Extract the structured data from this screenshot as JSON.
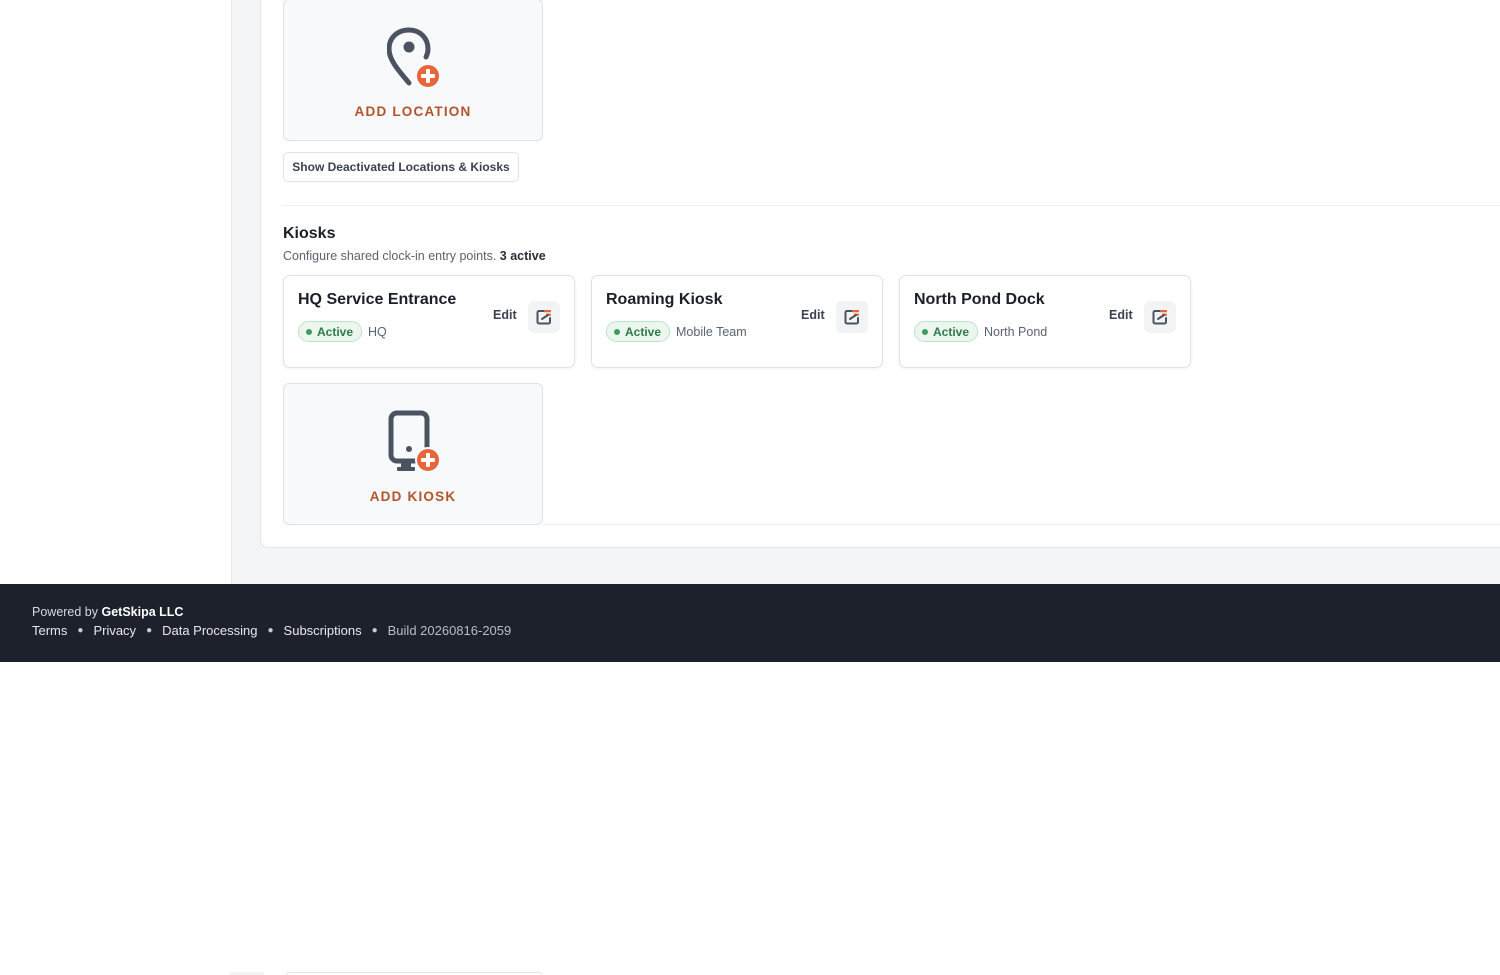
{
  "locations": {
    "add_label": "ADD LOCATION",
    "show_deactivated_label": "Show Deactivated Locations & Kiosks"
  },
  "kiosks": {
    "title": "Kiosks",
    "subtitle": "Configure shared clock-in entry points.",
    "active_count": "3 active",
    "items": [
      {
        "name": "HQ Service Entrance",
        "status": "Active",
        "location": "HQ",
        "edit_label": "Edit"
      },
      {
        "name": "Roaming Kiosk",
        "status": "Active",
        "location": "Mobile Team",
        "edit_label": "Edit"
      },
      {
        "name": "North Pond Dock",
        "status": "Active",
        "location": "North Pond",
        "edit_label": "Edit"
      }
    ],
    "add_label": "ADD KIOSK"
  },
  "footer": {
    "powered_prefix": "Powered by",
    "company": "GetSkipa LLC",
    "links": [
      "Terms",
      "Privacy",
      "Data Processing",
      "Subscriptions"
    ],
    "build": "Build 20260816-2059"
  },
  "colors": {
    "accent": "#e8643a",
    "accent_text": "#b4532a",
    "icon_gray": "#4b5260",
    "active_green": "#2f7a4a",
    "footer_bg": "#1c212c"
  },
  "icons": {
    "add_location": "map-pin-plus-icon",
    "add_kiosk": "tablet-plus-icon",
    "open_kiosk": "open-external-icon"
  }
}
